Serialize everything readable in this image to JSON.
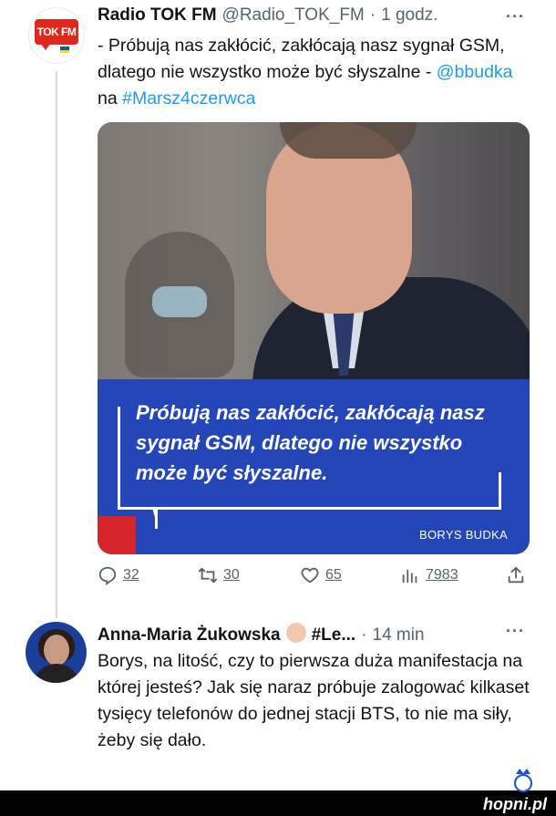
{
  "tweet1": {
    "avatar_logo_text": "TOK FM",
    "name": "Radio TOK FM",
    "handle": "@Radio_TOK_FM",
    "separator": "·",
    "time": "1 godz.",
    "more_icon": "more-icon",
    "text_plain": "- Próbują nas zakłócić, zakłócają nasz sygnał GSM, dlatego nie wszystko może być słyszalne -",
    "mention": "@bbudka",
    "text_mid": "na",
    "hashtag": "#Marsz4czerwca",
    "media": {
      "quote": "Próbują nas zakłócić, zakłócają nasz sygnał GSM, dlatego nie wszystko może być słyszalne.",
      "author": "BORYS BUDKA",
      "colors": {
        "panel": "#2446b8",
        "accent": "#d7262b"
      }
    },
    "actions": {
      "reply": {
        "icon": "reply-icon",
        "count": "32"
      },
      "retweet": {
        "icon": "retweet-icon",
        "count": "30"
      },
      "like": {
        "icon": "heart-icon",
        "count": "65"
      },
      "views": {
        "icon": "views-icon",
        "count": "7983"
      },
      "share": {
        "icon": "share-icon"
      }
    }
  },
  "tweet2": {
    "name": "Anna-Maria Żukowska",
    "name_suffix": "#Le...",
    "separator": "·",
    "time": "14 min",
    "more_icon": "more-icon",
    "text": "Borys, na litość, czy to pierwsza duża manifestacja na której jesteś? Jak się naraz próbuje zalogować kilkaset tysięcy telefonów do jednej stacji BTS, to nie ma siły, żeby się dało."
  },
  "watermark": "hopni.pl",
  "colors": {
    "link": "#1d9bf0",
    "muted": "#536471",
    "brand_red": "#e1261c"
  }
}
